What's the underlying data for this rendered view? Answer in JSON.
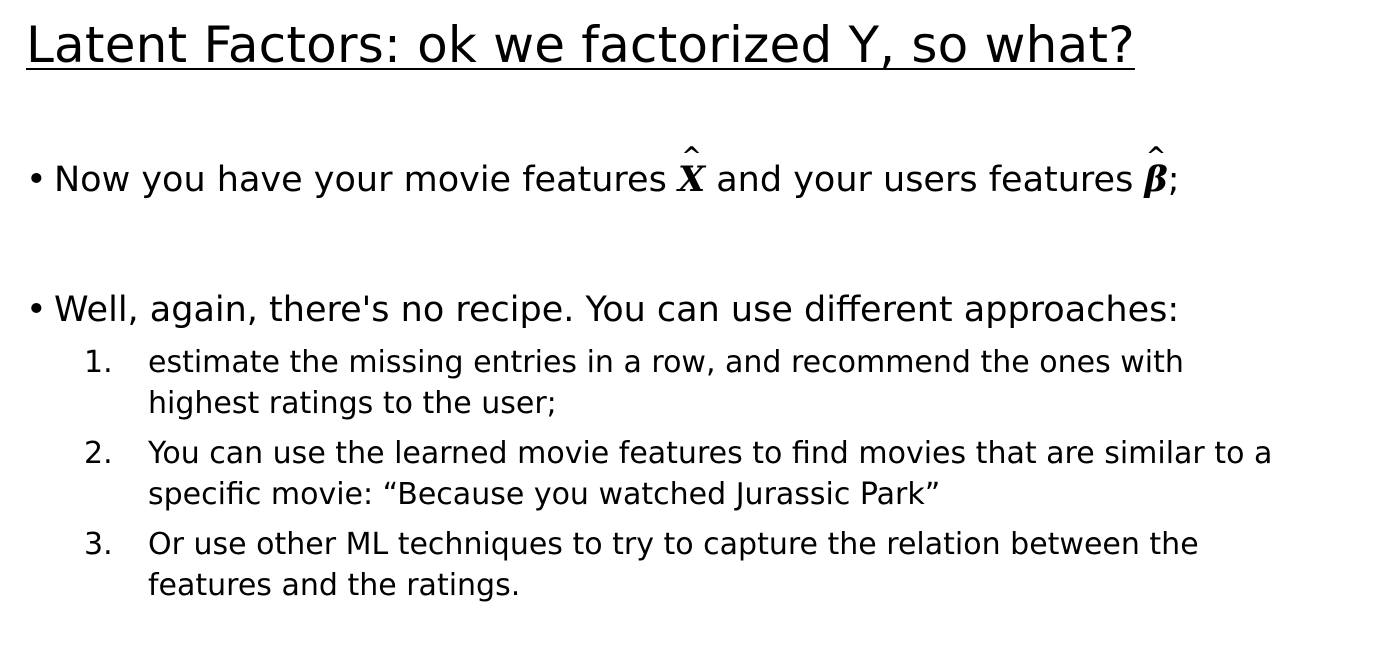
{
  "slide": {
    "title": "Latent Factors: ok we factorized Y, so what?",
    "bullet_symbol": "•",
    "bullet1": {
      "text_before_x": "Now you have your movie features ",
      "x_symbol": "X",
      "text_between": " and your users features ",
      "beta_symbol": "β",
      "text_after": ";",
      "hat_symbol": "^"
    },
    "bullet2": {
      "text": "Well, again, there's no recipe. You can use different approaches:"
    },
    "approaches": [
      {
        "number": "1.",
        "line1": "estimate the missing entries in a row, and recommend the ones with",
        "line2": "highest ratings to the user;"
      },
      {
        "number": "2.",
        "line1": "You can use the learned movie features to find movies that are similar to a",
        "line2": "specific movie: “Because you watched Jurassic Park”"
      },
      {
        "number": "3.",
        "line1": "Or use other ML techniques to try to capture the relation between the",
        "line2": "features and the ratings."
      }
    ]
  }
}
